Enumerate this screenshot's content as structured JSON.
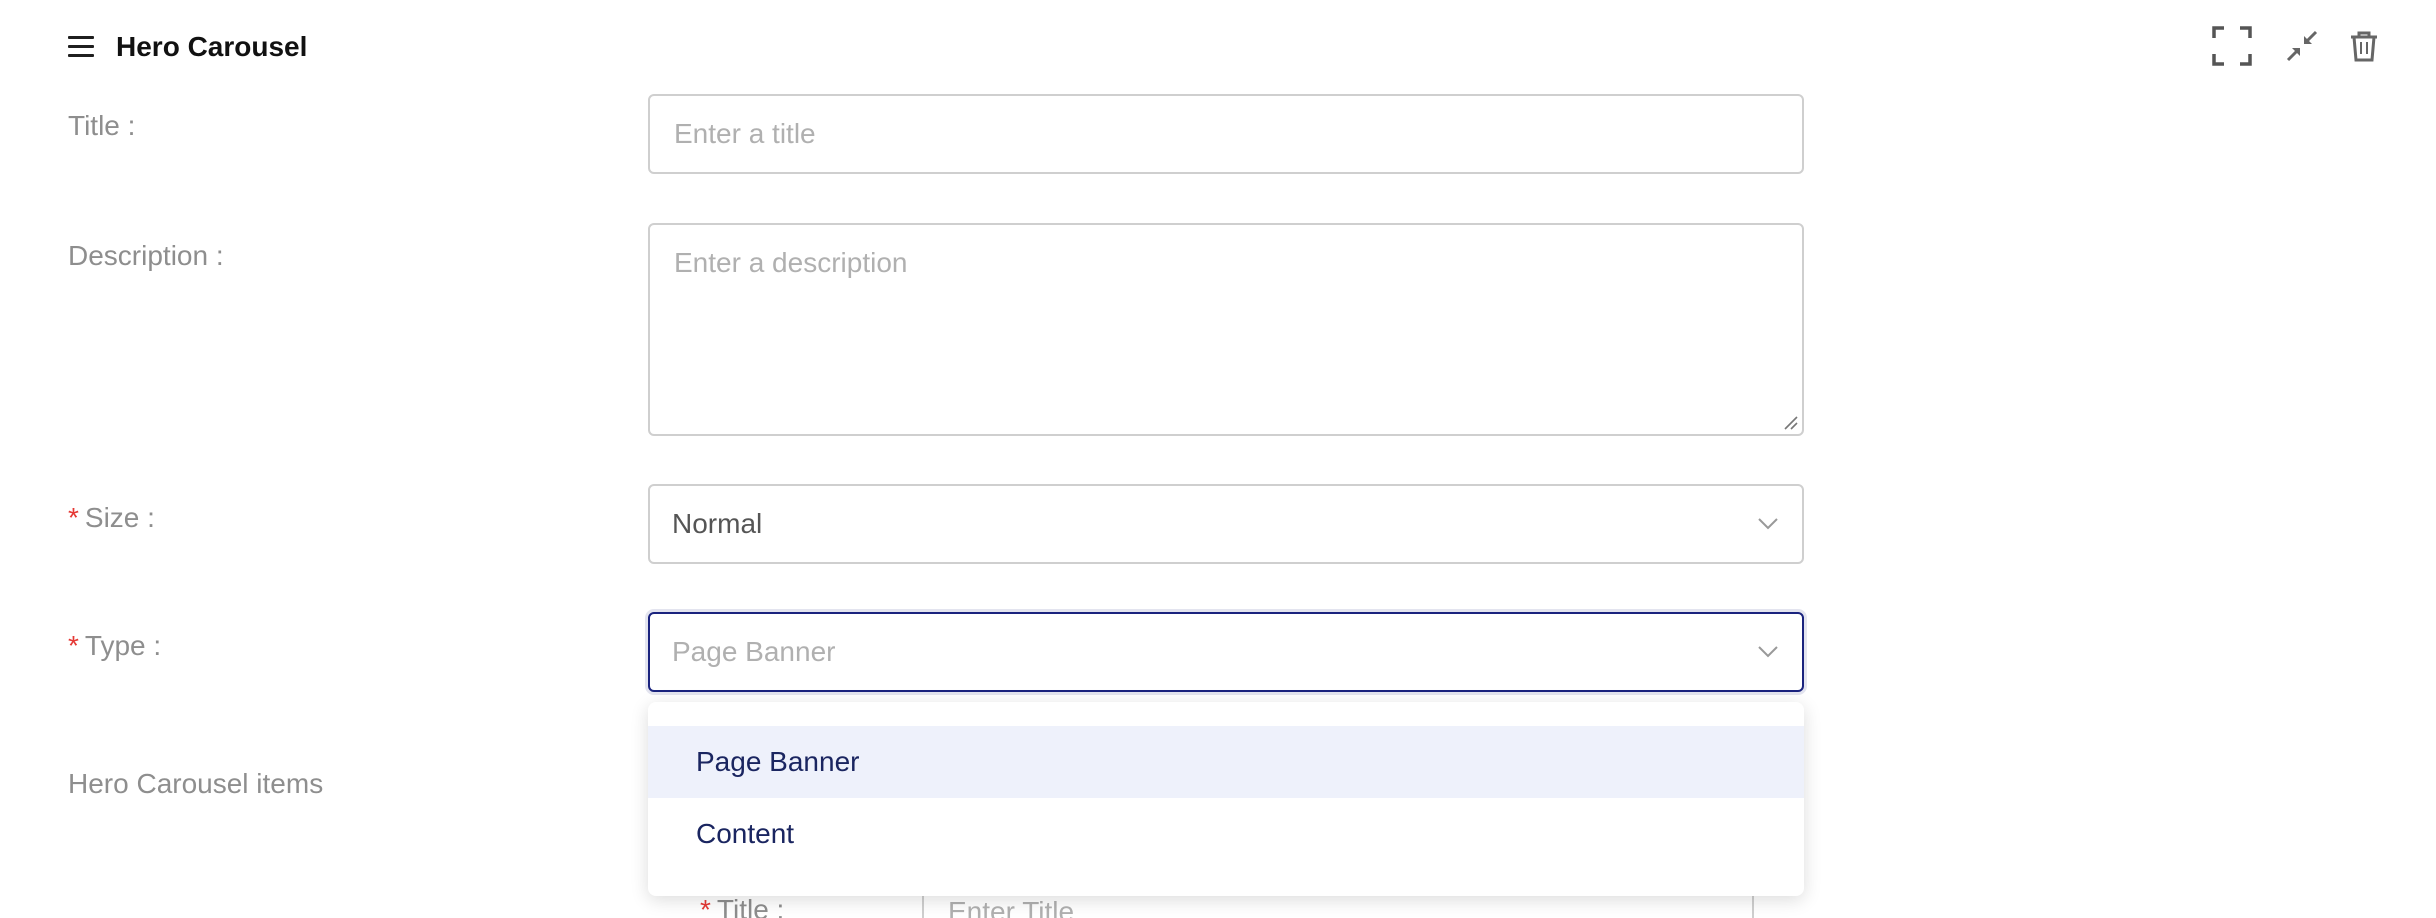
{
  "header": {
    "title": "Hero Carousel",
    "icons": [
      "hamburger-menu-icon",
      "fullscreen-icon",
      "collapse-icon",
      "trash-icon"
    ]
  },
  "form": {
    "title": {
      "label": "Title :",
      "placeholder": "Enter a title",
      "value": ""
    },
    "description": {
      "label": "Description :",
      "placeholder": "Enter a description",
      "value": ""
    },
    "size": {
      "required_mark": "*",
      "label": "Size :",
      "value": "Normal"
    },
    "type": {
      "required_mark": "*",
      "label": "Type :",
      "placeholder": "Page Banner",
      "options": [
        "Page Banner",
        "Content"
      ],
      "highlighted_option": "Page Banner"
    }
  },
  "items_section": {
    "label": "Hero Carousel items",
    "nested_title": {
      "required_mark": "*",
      "label": "Title :",
      "placeholder": "Enter Title"
    }
  },
  "colors": {
    "accent_border": "#1a237e",
    "required": "#e53935",
    "option_highlight": "#eef1fb",
    "option_text": "#1a2560"
  }
}
